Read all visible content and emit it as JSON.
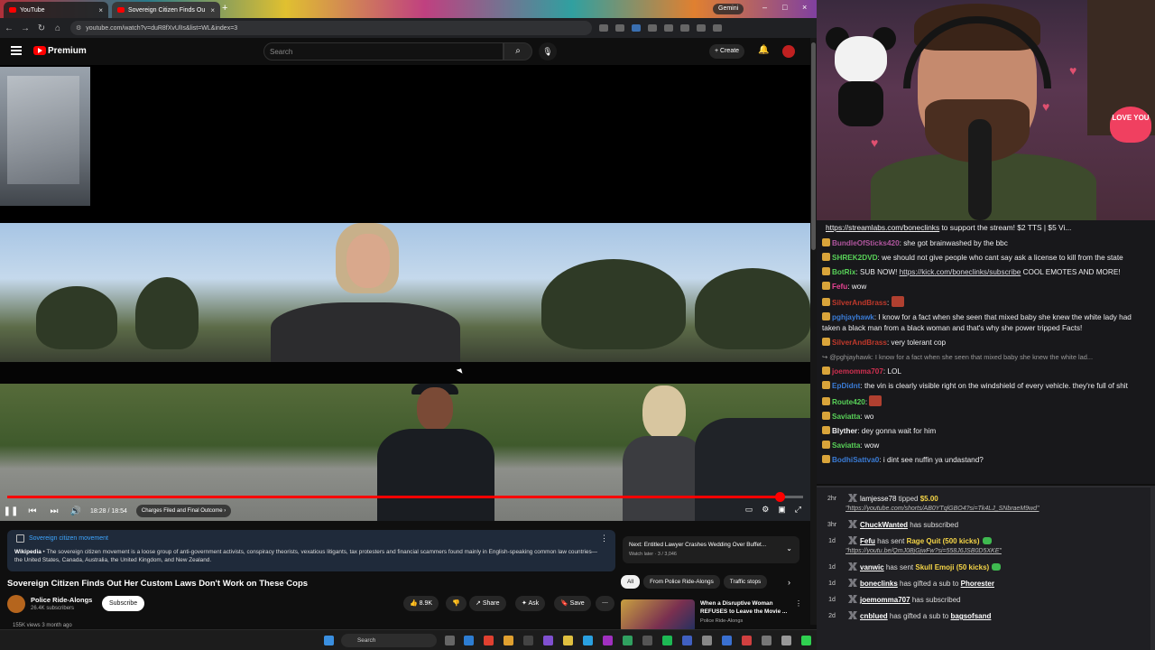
{
  "browser": {
    "tabs": [
      {
        "label": "YouTube"
      },
      {
        "label": "Sovereign Citizen Finds Ou"
      }
    ],
    "new_tab": "+",
    "gemini_label": "Gemini",
    "url": "youtube.com/watch?v=duR8fXvUlIs&list=WL&index=3"
  },
  "youtube": {
    "brand": "Premium",
    "search_placeholder": "Search",
    "create_label": "Create",
    "player": {
      "progress_fraction": 0.971,
      "time": "18:28 / 18:54",
      "chapter": "Charges Filed and Final Outcome"
    },
    "info_panel": {
      "title": "Sovereign citizen movement",
      "source": "Wikipedia",
      "text": " • The sovereign citizen movement is a loose group of anti-government activists, conspiracy theorists, vexatious litigants, tax protesters and financial scammers found mainly in English-speaking common law countries—the United States, Canada, Australia, the United Kingdom, and New Zealand."
    },
    "video_title": "Sovereign Citizen Finds Out Her Custom Laws Don't Work on These Cops",
    "channel": {
      "name": "Police Ride-Alongs",
      "subscribers": "26.4K subscribers",
      "subscribe_label": "Subscribe"
    },
    "actions": {
      "likes": "8.9K",
      "share": "Share",
      "ask": "Ask",
      "save": "Save"
    },
    "meta": "155K views  3 month ago",
    "next": {
      "title": "Next: Entitled Lawyer Crashes Wedding Over Buffet...",
      "sub": "Watch later · 3 / 3,046"
    },
    "chips": [
      "All",
      "From Police Ride-Alongs",
      "Traffic stops"
    ],
    "recommended": {
      "title": "When a Disruptive Woman REFUSES to Leave the Movie ...",
      "channel": "Police Ride-Alongs"
    }
  },
  "taskbar": {
    "search_label": "Search"
  },
  "webcam": {
    "love_sign": "LOVE YOU"
  },
  "chat": {
    "banner_link": "https://streamlabs.com/boneclinks",
    "banner_text": " to support the stream! $2 TTS | $5 Vi...",
    "messages": [
      {
        "user": "BundleOfSticks420",
        "color": "#b0569e",
        "text": "she got brainwashed by the bbc"
      },
      {
        "user": "SHREK2DVD",
        "color": "#58d158",
        "text": "we should not give people who cant say ask a license to kill from the state"
      },
      {
        "user": "BotRix",
        "color": "#58d158",
        "text": "SUB NOW! ",
        "link": "https://kick.com/boneclinks/subscribe",
        "after": " COOL EMOTES AND MORE!"
      },
      {
        "user": "Fefu",
        "color": "#e84393",
        "text": "wow"
      },
      {
        "user": "SilverAndBrass",
        "color": "#c0392b",
        "text": ""
      },
      {
        "user": "pghjayhawk",
        "color": "#3a7bd5",
        "text": "I know for a fact when she seen that mixed baby she knew the white lady had taken a black man from a black woman and that's why she power tripped Facts!"
      },
      {
        "user": "SilverAndBrass",
        "color": "#c0392b",
        "text": "very tolerant cop"
      },
      {
        "reply": "@pghjayhawk: I know for a fact when she seen that mixed baby she knew the white lad..."
      },
      {
        "user": "joemomma707",
        "color": "#d03050",
        "text": "LOL"
      },
      {
        "user": "EpDidnt",
        "color": "#3a7bd5",
        "text": "the vin is clearly visible right on the windshield of every vehicle. they're full of shit"
      },
      {
        "user": "Route420",
        "color": "#58d158",
        "text": ""
      },
      {
        "user": "Saviatta",
        "color": "#58d158",
        "text": "wo"
      },
      {
        "user": "Blyther",
        "color": "#efeff1",
        "text": "dey gonna wait for him"
      },
      {
        "user": "Saviatta",
        "color": "#58d158",
        "text": "wow"
      },
      {
        "user": "BodhiSattva0",
        "color": "#3a7bd5",
        "text": "i dint see nuffin ya undastand?"
      }
    ]
  },
  "feed": [
    {
      "ago": "2hr",
      "user": "lamjesse78",
      "plain": true,
      "action": " tipped ",
      "highlight": "$5.00",
      "sub": "https://youtube.com/shorts/AB0YTqlGBO4?si=Tk4LJ_SNbraeM9wd"
    },
    {
      "ago": "3hr",
      "user": "ChuckWanted",
      "action": " has subscribed"
    },
    {
      "ago": "1d",
      "user": "Fefu",
      "action": " has sent ",
      "highlight": "Rage Quit (500 kicks)",
      "gem": true,
      "sub": "https://youtu.be/QmJ0BjGjwFw?si=558J6JSB0D5XKE"
    },
    {
      "ago": "1d",
      "user": "vanwic",
      "action": " has sent ",
      "highlight": "Skull Emoji (50 kicks)",
      "gem": true
    },
    {
      "ago": "1d",
      "user": "boneclinks",
      "action": " has gifted a sub to ",
      "target": "Phorester"
    },
    {
      "ago": "1d",
      "user": "joemomma707",
      "action": " has subscribed"
    },
    {
      "ago": "2d",
      "user": "cnblued",
      "action": " has gifted a sub to ",
      "target": "bagsofsand"
    }
  ],
  "colors": {
    "accent": "#ff0000",
    "link": "#3ea6ff",
    "tip": "#f5d547",
    "kick_gem": "#3fb950"
  }
}
